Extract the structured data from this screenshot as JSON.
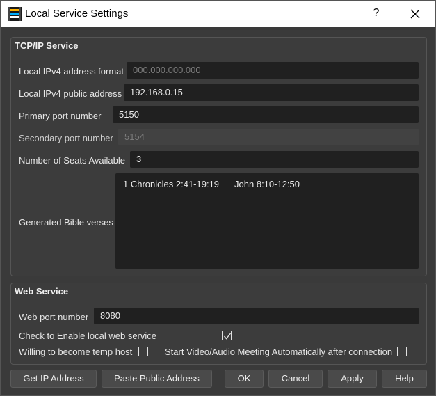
{
  "window": {
    "title": "Local Service Settings",
    "help_glyph": "?",
    "close_icon": "close-icon",
    "app_icon": "app-icon"
  },
  "tcp_group": {
    "title": "TCP/IP Service",
    "ipv4_format": {
      "label": "Local IPv4 address format",
      "placeholder": "000.000.000.000"
    },
    "ipv4_public": {
      "label": "Local IPv4 public address",
      "value": "192.168.0.15"
    },
    "primary_port": {
      "label": "Primary  port  number",
      "value": "5150"
    },
    "secondary_port": {
      "label": "Secondary port number",
      "value": "5154"
    },
    "seats": {
      "label": "Number of Seats Available",
      "value": "3"
    },
    "verses": {
      "label": "Generated Bible verses",
      "items": [
        "1 Chronicles 2:41-19:19",
        "John 8:10-12:50"
      ]
    }
  },
  "web_group": {
    "title": "Web Service",
    "web_port": {
      "label": "Web port number",
      "value": "8080"
    },
    "enable_web": {
      "label": "Check to Enable local web service",
      "checked": true
    },
    "temp_host": {
      "label": "Willing to become temp host",
      "checked": false
    },
    "auto_meeting": {
      "label": "Start Video/Audio Meeting Automatically after connection",
      "checked": false
    }
  },
  "buttons": {
    "get_ip": "Get IP Address",
    "paste_public": "Paste Public Address",
    "ok": "OK",
    "cancel": "Cancel",
    "apply": "Apply",
    "help": "Help"
  },
  "colors": {
    "window_bg": "#3a3a3a",
    "field_bg": "#202020",
    "disabled_field_bg": "#424242",
    "titlebar_bg": "#ffffff"
  }
}
